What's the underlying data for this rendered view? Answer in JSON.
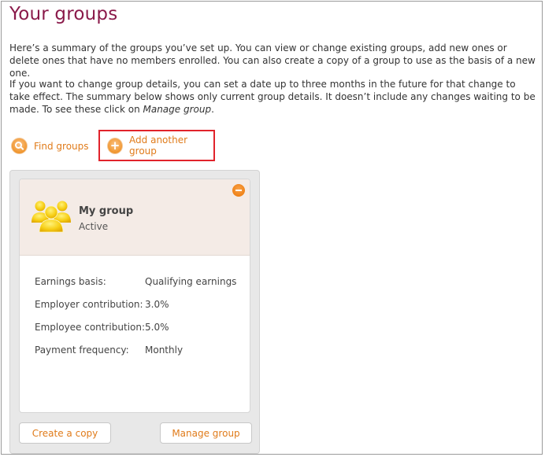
{
  "page": {
    "title": "Your groups",
    "intro1": "Here’s a summary of the groups you’ve set up. You can view or change existing groups, add new ones or delete ones that have no members enrolled. You can also create a copy of a group to use as the basis of a new one.",
    "intro2_main": "If you want to change group details, you can set a date up to three months in the future for that change to take effect. The summary below shows only current group details. It doesn’t include any changes waiting to be made. To see these click on ",
    "intro2_link": "Manage group",
    "intro2_end": "."
  },
  "actions": {
    "find_label": "Find groups",
    "add_label": "Add another group",
    "find_icon": "search-icon",
    "add_icon": "plus-icon"
  },
  "group": {
    "name": "My group",
    "status": "Active",
    "icon": "people-group-icon",
    "remove_icon": "minus-icon",
    "details": [
      {
        "label": "Earnings basis:",
        "value": "Qualifying earnings"
      },
      {
        "label": "Employer contribution:",
        "value": "3.0%"
      },
      {
        "label": "Employee contribution:",
        "value": "5.0%"
      },
      {
        "label": "Payment frequency:",
        "value": "Monthly"
      }
    ],
    "copy_label": "Create a copy",
    "manage_label": "Manage group"
  },
  "colors": {
    "title": "#8a1a4a",
    "accent": "#e07b1a",
    "highlight_border": "#e1232b",
    "card_header": "#f4ebe6"
  }
}
